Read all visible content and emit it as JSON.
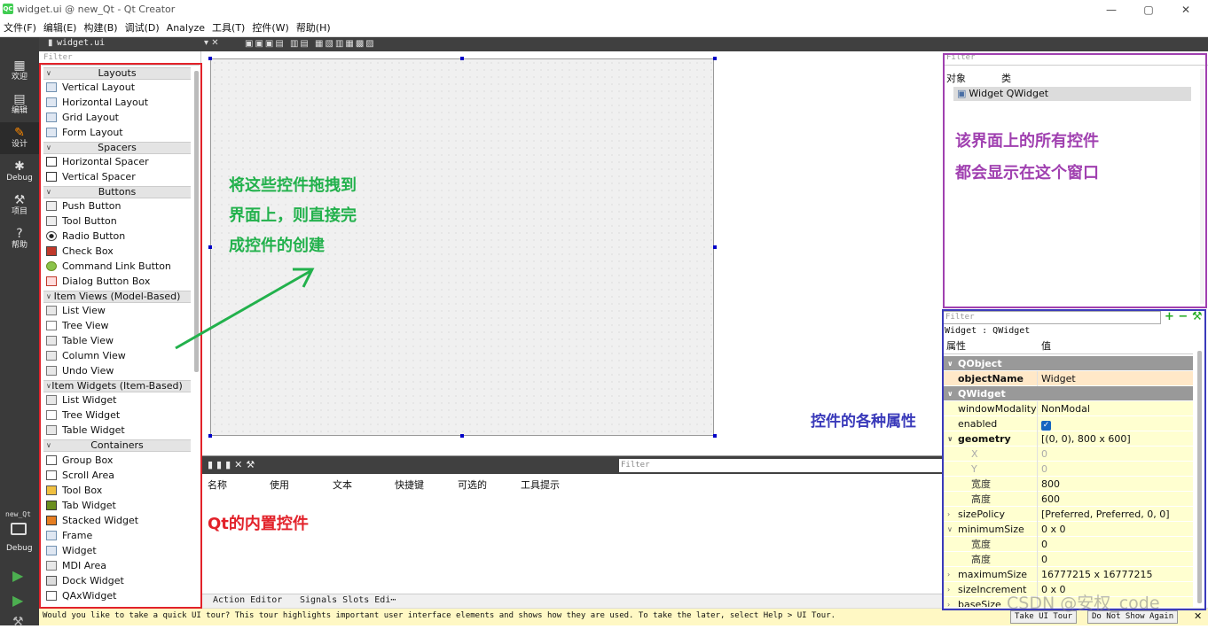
{
  "window": {
    "title": "widget.ui @ new_Qt - Qt Creator",
    "app_icon": "QC",
    "controls": [
      "—",
      "▢",
      "✕"
    ]
  },
  "menu": [
    "文件(F)",
    "编辑(E)",
    "构建(B)",
    "调试(D)",
    "Analyze",
    "工具(T)",
    "控件(W)",
    "帮助(H)"
  ],
  "modes": [
    {
      "label": "欢迎",
      "icon": "grid-icon"
    },
    {
      "label": "编辑",
      "icon": "edit-doc-icon"
    },
    {
      "label": "设计",
      "icon": "pencil-icon"
    },
    {
      "label": "Debug",
      "icon": "bug-icon"
    },
    {
      "label": "项目",
      "icon": "wrench-icon"
    },
    {
      "label": "帮助",
      "icon": "help-icon"
    }
  ],
  "kit": {
    "project": "new_Qt",
    "build": "Debug"
  },
  "toolbar": {
    "file": "widget.ui"
  },
  "widget_box": {
    "filter_placeholder": "Filter",
    "categories": {
      "layouts": "Layouts",
      "spacers": "Spacers",
      "buttons": "Buttons",
      "item_views": "Item Views (Model-Based)",
      "item_widgets": "Item Widgets (Item-Based)",
      "containers": "Containers"
    },
    "items": {
      "vertical_layout": "Vertical Layout",
      "horizontal_layout": "Horizontal Layout",
      "grid_layout": "Grid Layout",
      "form_layout": "Form Layout",
      "horizontal_spacer": "Horizontal Spacer",
      "vertical_spacer": "Vertical Spacer",
      "push_button": "Push Button",
      "tool_button": "Tool Button",
      "radio_button": "Radio Button",
      "check_box": "Check Box",
      "command_link_button": "Command Link Button",
      "dialog_button_box": "Dialog Button Box",
      "list_view": "List View",
      "tree_view": "Tree View",
      "table_view": "Table View",
      "column_view": "Column View",
      "undo_view": "Undo View",
      "list_widget": "List Widget",
      "tree_widget": "Tree Widget",
      "table_widget": "Table Widget",
      "group_box": "Group Box",
      "scroll_area": "Scroll Area",
      "tool_box": "Tool Box",
      "tab_widget": "Tab Widget",
      "stacked_widget": "Stacked Widget",
      "frame": "Frame",
      "widget": "Widget",
      "mdi_area": "MDI Area",
      "dock_widget": "Dock Widget",
      "qax_widget": "QAxWidget"
    }
  },
  "action_editor": {
    "filter_placeholder": "Filter",
    "columns": [
      "名称",
      "使用",
      "文本",
      "快捷键",
      "可选的",
      "工具提示"
    ],
    "tabs": [
      "Action Editor",
      "Signals  Slots Edi⋯"
    ]
  },
  "object_inspector": {
    "filter_placeholder": "Filter",
    "col_object": "对象",
    "col_class": "类",
    "row": "Widget QWidget"
  },
  "property_editor": {
    "filter_placeholder": "Filter",
    "class_label": "Widget : QWidget",
    "col_property": "属性",
    "col_value": "值",
    "rows": {
      "qobject": "QObject",
      "objectname_k": "objectName",
      "objectname_v": "Widget",
      "qwidget": "QWidget",
      "windowmodality_k": "windowModality",
      "windowmodality_v": "NonModal",
      "enabled_k": "enabled",
      "geometry_k": "geometry",
      "geometry_v": "[(0, 0), 800 x 600]",
      "x_k": "X",
      "x_v": "0",
      "y_k": "Y",
      "y_v": "0",
      "width_k": "宽度",
      "width_v": "800",
      "height_k": "高度",
      "height_v": "600",
      "sizepolicy_k": "sizePolicy",
      "sizepolicy_v": "[Preferred, Preferred, 0, 0]",
      "minsize_k": "minimumSize",
      "minsize_v": "0 x 0",
      "minw_k": "宽度",
      "minw_v": "0",
      "minh_k": "高度",
      "minh_v": "0",
      "maxsize_k": "maximumSize",
      "maxsize_v": "16777215 x 16777215",
      "sizeinc_k": "sizeIncrement",
      "sizeinc_v": "0 x 0",
      "basesize_k": "baseSize"
    }
  },
  "tour": {
    "message": "Would you like to take a quick UI tour? This tour highlights important user interface elements and shows how they are used. To take the later, select Help > UI Tour.",
    "take_button": "Take UI Tour",
    "dont_show_button": "Do Not Show Again"
  },
  "annotations": {
    "drag_line1": "将这些控件拖拽到",
    "drag_line2": "界面上，则直接完",
    "drag_line3": "成控件的创建",
    "builtin": "Qt的内置控件",
    "objects_line1": "该界面上的所有控件",
    "objects_line2": "都会显示在这个窗口",
    "properties": "控件的各种属性"
  },
  "watermark": "CSDN @安权_code",
  "colors": {
    "red": "#e2222a",
    "green": "#22b14c",
    "purple": "#a040b0",
    "blue": "#3a3aba"
  }
}
